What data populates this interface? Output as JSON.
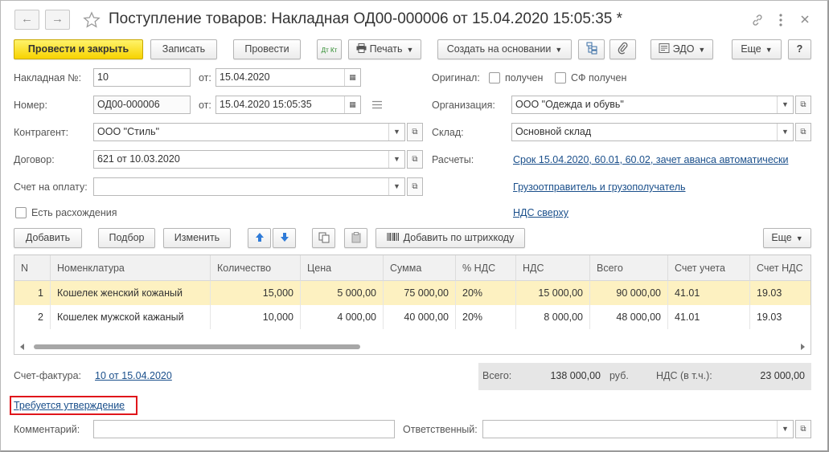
{
  "title": "Поступление товаров: Накладная ОД00-000006 от 15.04.2020 15:05:35 *",
  "nav": {
    "back": "←",
    "forward": "→"
  },
  "toolbar": {
    "post_close": "Провести и закрыть",
    "save": "Записать",
    "post": "Провести",
    "dtkt": "Дт Кт",
    "print": "Печать",
    "create_based": "Создать на основании",
    "edo": "ЭДО",
    "more": "Еще",
    "help": "?"
  },
  "form": {
    "invoice_no_label": "Накладная №:",
    "invoice_no_value": "10",
    "from_label": "от:",
    "invoice_date": "15.04.2020",
    "number_label": "Номер:",
    "number_value": "ОД00-000006",
    "number_date": "15.04.2020 15:05:35",
    "original_label": "Оригинал:",
    "received_label": "получен",
    "sf_received_label": "СФ получен",
    "org_label": "Организация:",
    "org_value": "ООО \"Одежда и обувь\"",
    "contractor_label": "Контрагент:",
    "contractor_value": "ООО \"Стиль\"",
    "warehouse_label": "Склад:",
    "warehouse_value": "Основной склад",
    "contract_label": "Договор:",
    "contract_value": "621 от 10.03.2020",
    "settlements_label": "Расчеты:",
    "settlements_link": "Срок 15.04.2020, 60.01, 60.02, зачет аванса автоматически",
    "pay_account_label": "Счет на оплату:",
    "pay_account_value": "",
    "shipper_link": "Грузоотправитель и грузополучатель",
    "discrepancies_label": "Есть расхождения",
    "vat_link": "НДС сверху"
  },
  "table_toolbar": {
    "add": "Добавить",
    "pick": "Подбор",
    "change": "Изменить",
    "add_barcode": "Добавить по штрихкоду",
    "more": "Еще"
  },
  "table": {
    "columns": [
      "N",
      "Номенклатура",
      "Количество",
      "Цена",
      "Сумма",
      "% НДС",
      "НДС",
      "Всего",
      "Счет учета",
      "Счет НДС"
    ],
    "rows": [
      [
        "1",
        "Кошелек женский кожаный",
        "15,000",
        "5 000,00",
        "75 000,00",
        "20%",
        "15 000,00",
        "90 000,00",
        "41.01",
        "19.03"
      ],
      [
        "2",
        "Кошелек мужской кажаный",
        "10,000",
        "4 000,00",
        "40 000,00",
        "20%",
        "8 000,00",
        "48 000,00",
        "41.01",
        "19.03"
      ]
    ]
  },
  "footer": {
    "invoice_label": "Счет-фактура:",
    "invoice_link": "10 от 15.04.2020",
    "total_label": "Всего:",
    "total_value": "138 000,00",
    "currency": "руб.",
    "vat_label": "НДС (в т.ч.):",
    "vat_value": "23 000,00",
    "approval_link": "Требуется утверждение",
    "comment_label": "Комментарий:",
    "comment_value": "",
    "responsible_label": "Ответственный:",
    "responsible_value": ""
  },
  "colors": {
    "accent": "#f7d300",
    "link": "#1a4f8b",
    "highlight": "#e0161b",
    "selected_row": "#fdf1c1"
  }
}
